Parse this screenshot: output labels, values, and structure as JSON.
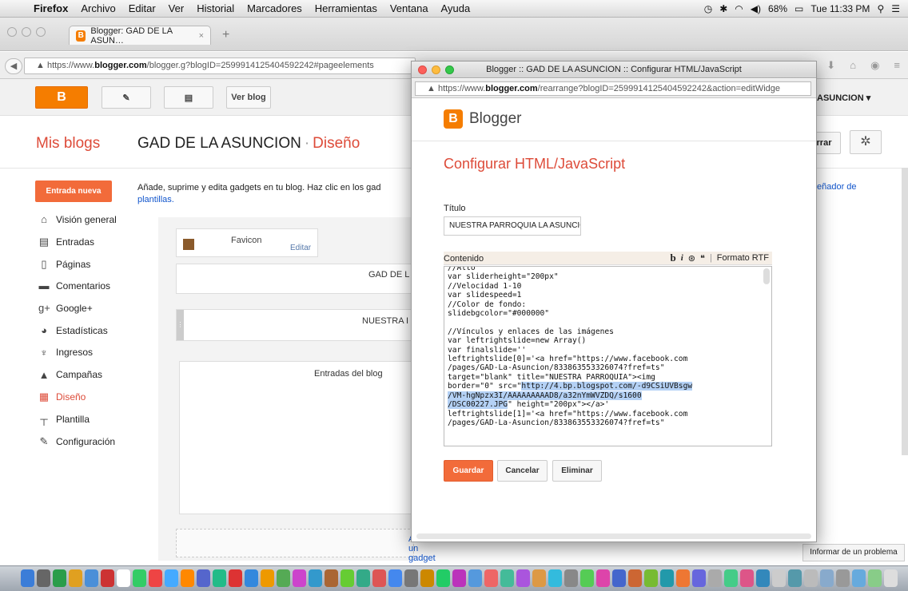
{
  "menubar": {
    "app": "Firefox",
    "items": [
      "Archivo",
      "Editar",
      "Ver",
      "Historial",
      "Marcadores",
      "Herramientas",
      "Ventana",
      "Ayuda"
    ],
    "battery": "68%",
    "clock": "Tue 11:33 PM"
  },
  "browser": {
    "tab_title": "Blogger: GAD DE LA ASUN…",
    "url_prefix": "https://www.",
    "url_domain": "blogger.com",
    "url_rest": "/blogger.g?blogID=2599914125404592242#pageelements"
  },
  "header": {
    "ver_blog": "Ver blog",
    "blog_short": "ASUNCION",
    "logo": "B"
  },
  "title": {
    "mis_blogs": "Mis blogs",
    "blog": "GAD DE LA ASUNCION",
    "sep": "·",
    "section": "Diseño",
    "rarbtn": "rrar"
  },
  "sidebar": {
    "new_post": "Entrada nueva",
    "items": [
      {
        "label": "Visión general",
        "icon": "home-icon"
      },
      {
        "label": "Entradas",
        "icon": "posts-icon"
      },
      {
        "label": "Páginas",
        "icon": "pages-icon"
      },
      {
        "label": "Comentarios",
        "icon": "comments-icon"
      },
      {
        "label": "Google+",
        "icon": "google-plus-icon"
      },
      {
        "label": "Estadísticas",
        "icon": "stats-icon"
      },
      {
        "label": "Ingresos",
        "icon": "earnings-icon"
      },
      {
        "label": "Campañas",
        "icon": "campaigns-icon"
      },
      {
        "label": "Diseño",
        "icon": "layout-icon"
      },
      {
        "label": "Plantilla",
        "icon": "template-icon"
      },
      {
        "label": "Configuración",
        "icon": "settings-icon"
      }
    ]
  },
  "main": {
    "intro": "Añade, suprime y edita gadgets en tu blog. Haz clic en los gad",
    "intro_link": "plantillas.",
    "favicon": "Favicon",
    "edit": "Editar",
    "gadget_header": "GAD DE L",
    "gadget_nuestra": "NUESTRA I",
    "entradas": "Entradas del blog",
    "add_gadget": "Añadir un gadget",
    "right_link": "eñador de",
    "report": "Informar de un problema"
  },
  "popup": {
    "window_title": "Blogger :: GAD DE LA ASUNCION :: Configurar HTML/JavaScript",
    "url_prefix": "https://www.",
    "url_domain": "blogger.com",
    "url_rest": "/rearrange?blogID=2599914125404592242&action=editWidge",
    "brand": "Blogger",
    "heading": "Configurar HTML/JavaScript",
    "title_label": "Título",
    "title_value": "NUESTRA PARROQUIA LA ASUNCIO",
    "content_label": "Contenido",
    "rtf": "Formato RTF",
    "code_before": "//Alto\nvar sliderheight=\"200px\"\n//Velocidad 1-10\nvar slidespeed=1\n//Color de fondo:\nslidebgcolor=\"#000000\"\n\n//Vínculos y enlaces de las imágenes\nvar leftrightslide=new Array()\nvar finalslide=''\nleftrightslide[0]='<a href=\"https://www.facebook.com\n/pages/GAD-La-Asuncion/833863553326074?fref=ts\"\ntarget=\"blank\" title=\"NUESTRA PARROQUIA\"><img\nborder=\"0\" src=\"",
    "code_highlight": "http://4.bp.blogspot.com/-d9CSiUVBsgw\n/VM-hgNpzx3I/AAAAAAAAAD8/a32nYmWVZDQ/s1600\n/DSC00227.JPG",
    "code_after": "\" height=\"200px\"></a>'\nleftrightslide[1]='<a href=\"https://www.facebook.com\n/pages/GAD-La-Asuncion/833863553326074?fref=ts\"",
    "save": "Guardar",
    "cancel": "Cancelar",
    "delete": "Eliminar"
  },
  "colors": {
    "accent": "#dd4b39",
    "blogger_orange": "#f57d00",
    "button_orange": "#f26b3a",
    "link": "#1155cc"
  }
}
